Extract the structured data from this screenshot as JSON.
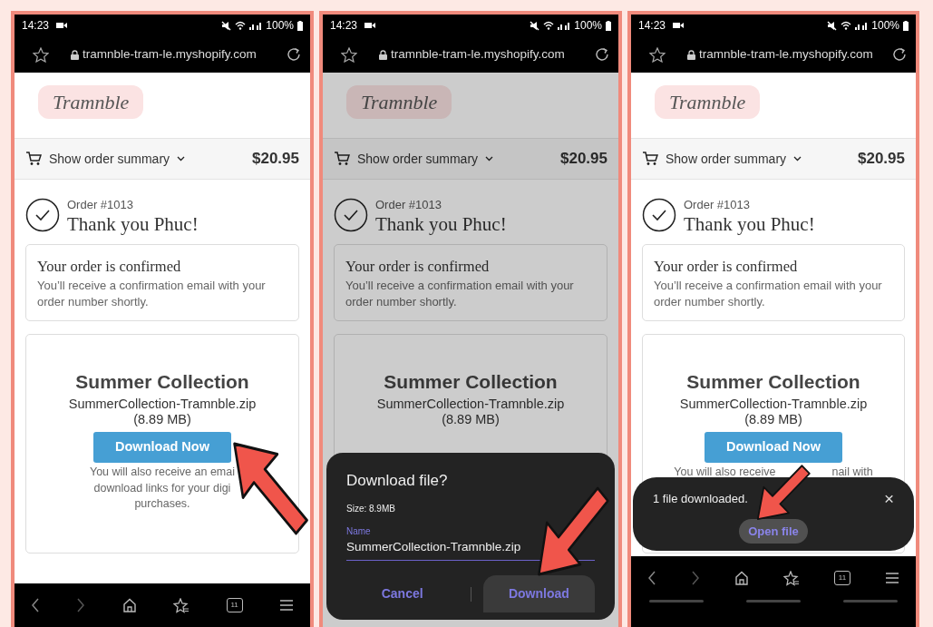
{
  "panels": [
    {
      "status": {
        "time": "14:23",
        "battery": "100%"
      },
      "url": "tramnble-tram-le.myshopify.com",
      "brand": "Tramnble",
      "dimmed": false,
      "summary": {
        "label": "Show order summary",
        "total": "$20.95"
      },
      "order": {
        "number": "Order #1013",
        "thanks": "Thank you Phuc!"
      },
      "confirmed": {
        "title": "Your order is confirmed",
        "text": "You’ll receive a confirmation email with your order number shortly."
      },
      "product": {
        "title": "Summer Collection",
        "file": "SummerCollection-Tramnble.zip",
        "size": "(8.89 MB)",
        "button": "Download Now",
        "note_lines": [
          [
            "You will also receive an emai"
          ],
          [
            "download links for your digi"
          ],
          [
            "purchases."
          ]
        ]
      },
      "nav": {
        "tab_count": "11"
      },
      "gesture_bar": false,
      "pointer": {
        "kind": "up-left"
      }
    },
    {
      "status": {
        "time": "14:23",
        "battery": "100%"
      },
      "url": "tramnble-tram-le.myshopify.com",
      "brand": "Tramnble",
      "dimmed": true,
      "summary": {
        "label": "Show order summary",
        "total": "$20.95"
      },
      "order": {
        "number": "Order #1013",
        "thanks": "Thank you Phuc!"
      },
      "confirmed": {
        "title": "Your order is confirmed",
        "text": "You’ll receive a confirmation email with your order number shortly."
      },
      "product": {
        "title": "Summer Collection",
        "file": "SummerCollection-Tramnble.zip",
        "size": "(8.89 MB)"
      },
      "dialog": {
        "title": "Download file?",
        "size": "Size: 8.9MB",
        "field_label": "Name",
        "field_value": "SummerCollection-Tramnble.zip",
        "cancel": "Cancel",
        "confirm": "Download"
      },
      "gesture_bar": false,
      "pointer": {
        "kind": "down-left"
      }
    },
    {
      "status": {
        "time": "14:23",
        "battery": "100%"
      },
      "url": "tramnble-tram-le.myshopify.com",
      "brand": "Tramnble",
      "dimmed": false,
      "summary": {
        "label": "Show order summary",
        "total": "$20.95"
      },
      "order": {
        "number": "Order #1013",
        "thanks": "Thank you Phuc!"
      },
      "confirmed": {
        "title": "Your order is confirmed",
        "text": "You’ll receive a confirmation email with your order number shortly."
      },
      "product": {
        "title": "Summer Collection",
        "file": "SummerCollection-Tramnble.zip",
        "size": "(8.89 MB)",
        "button": "Download Now",
        "note_lines": [
          [
            "You will also receive",
            "nail with"
          ]
        ]
      },
      "snackbar": {
        "text": "1 file downloaded.",
        "close": "×",
        "action": "Open file"
      },
      "nav": {
        "tab_count": "11"
      },
      "gesture_bar": true,
      "pointer": {
        "kind": "down-left"
      }
    }
  ]
}
